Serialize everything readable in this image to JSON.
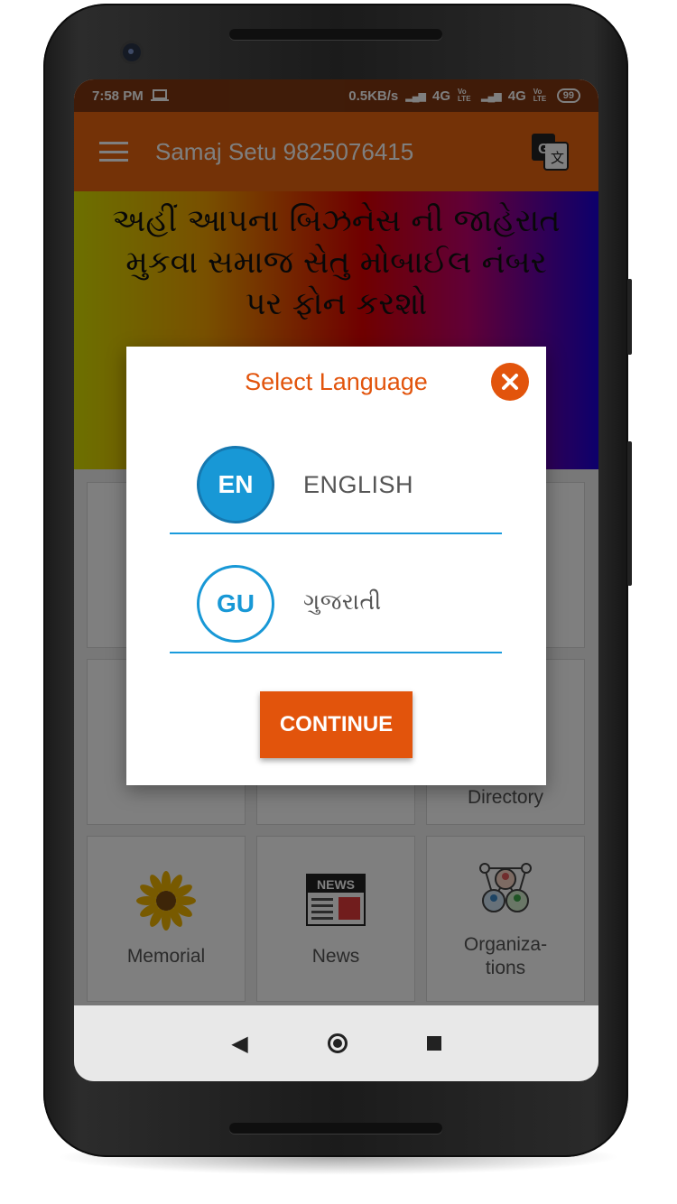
{
  "status_bar": {
    "time": "7:58 PM",
    "speed": "0.5KB/s",
    "network1": "4G",
    "volte1": "Vo LTE",
    "network2": "4G",
    "volte2": "Vo LTE",
    "battery": "99"
  },
  "app_bar": {
    "title": "Samaj Setu 9825076415"
  },
  "banner": {
    "line1": "અહીં આપના બિઝનેસ ની જાહેરાત",
    "line2": "મુકવા સમાજ સેતુ મોબાઈલ નંબર",
    "line3": "પર ફોન કરશો"
  },
  "grid": {
    "directory_label": "Directory",
    "tiles": [
      {
        "label": "Memorial",
        "icon": "sunflower-icon"
      },
      {
        "label": "News",
        "icon": "newspaper-icon"
      },
      {
        "label": "Organiza-\ntions",
        "icon": "people-network-icon"
      }
    ]
  },
  "dialog": {
    "title": "Select Language",
    "options": [
      {
        "code": "EN",
        "name": "ENGLISH"
      },
      {
        "code": "GU",
        "name": "ગુજરાતી"
      }
    ],
    "continue_label": "CONTINUE"
  },
  "colors": {
    "primary": "#e8650f",
    "accent": "#e2540c",
    "blue": "#1898d6"
  }
}
